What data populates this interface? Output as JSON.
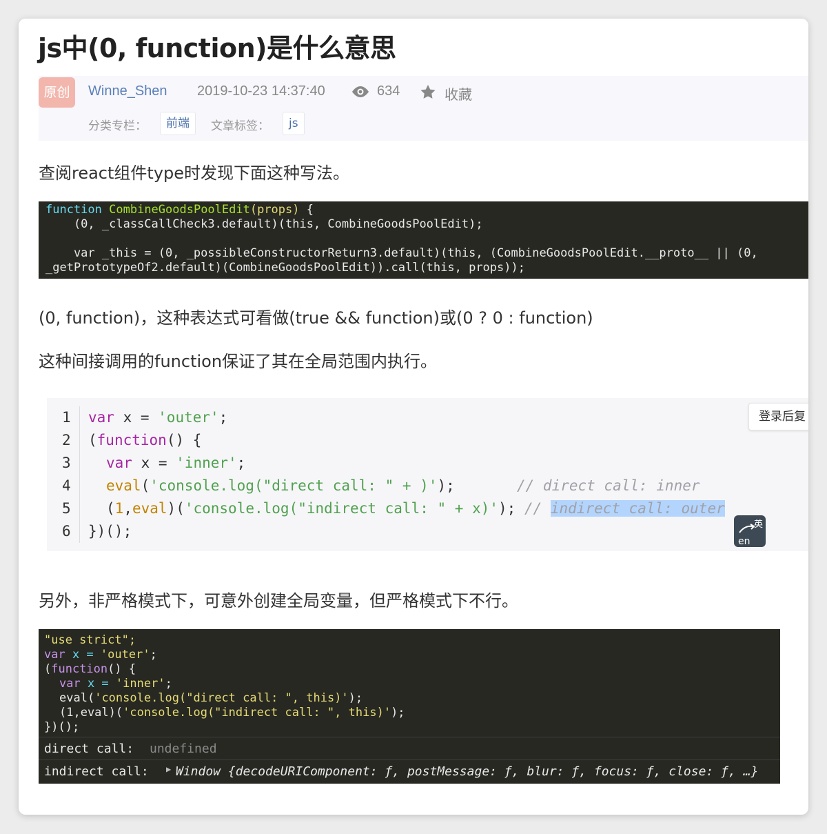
{
  "article": {
    "title": "js中(0, function)是什么意思",
    "badge": "原创",
    "author": "Winne_Shen",
    "date": "2019-10-23 14:37:40",
    "views": "634",
    "favorite": "收藏",
    "category_label": "分类专栏：",
    "category": "前端",
    "tags_label": "文章标签：",
    "tag": "js"
  },
  "paragraphs": {
    "p1": "查阅react组件type时发现下面这种写法。",
    "p2": "(0, function)，这种表达式可看做(true && function)或(0 ? 0 : function)",
    "p3": "这种间接调用的function保证了其在全局范围内执行。",
    "p4": "另外，非严格模式下，可意外创建全局变量，但严格模式下不行。"
  },
  "code1": {
    "l1_kw": "function",
    "l1_fn": "CombineGoodsPoolEdit",
    "l1_args": "(props)",
    "l1_brace": " {",
    "l2": "    (0, _classCallCheck3.default)(this, CombineGoodsPoolEdit);",
    "l3": "",
    "l4": "    var _this = (0, _possibleConstructorReturn3.default)(this, (CombineGoodsPoolEdit.__proto__ || (0,",
    "l5": "_getPrototypeOf2.default)(CombineGoodsPoolEdit)).call(this, props));"
  },
  "code2": {
    "line_numbers": [
      "1",
      "2",
      "3",
      "4",
      "5",
      "6"
    ],
    "lines": {
      "l1_kw": "var",
      "l1_rest": " x = ",
      "l1_str": "'outer'",
      "l1_end": ";",
      "l2_open": "(",
      "l2_kw": "function",
      "l2_rest": "() {",
      "l3_kw": "var",
      "l3_rest": " x = ",
      "l3_str": "'inner'",
      "l3_end": ";",
      "l4_fn": "eval",
      "l4_open": "(",
      "l4_str": "'console.log(\"direct call: \" + )'",
      "l4_end": ");",
      "l4_cm": "// direct call: inner",
      "l5_open": "(",
      "l5_num": "1",
      "l5_comma": ",",
      "l5_fn": "eval",
      "l5_mid": ")(",
      "l5_str": "'console.log(\"indirect call: \" + x)'",
      "l5_end": "); ",
      "l5_cm": "// ",
      "l5_sel": "indirect call: outer",
      "l6": "})();"
    },
    "login_button": "登录后复"
  },
  "code3": {
    "l1": "\"use strict\";",
    "l2_kw": "var",
    "l2_rest": " x = ",
    "l2_str": "'outer'",
    "l2_end": ";",
    "l3_open": "(",
    "l3_kw": "function",
    "l3_rest": "() {",
    "l4_kw": "var",
    "l4_rest": " x = ",
    "l4_str": "'inner'",
    "l4_end": ";",
    "l5_fn": "eval",
    "l5_open": "(",
    "l5_str": "'console.log(\"direct call: \", this)'",
    "l5_end": ");",
    "l6_open": "(1,eval)(",
    "l6_str": "'console.log(\"indirect call: \", this)'",
    "l6_end": ");",
    "l7": "})();",
    "out1_label": "direct call:",
    "out1_value": "undefined",
    "out2_label": "indirect call:",
    "out2_arrow": "▶",
    "out2_value": "Window {decodeURIComponent: ƒ, postMessage: ƒ, blur: ƒ, focus: ƒ, close: ƒ, …}"
  },
  "ime": {
    "top": "英",
    "bottom": "en"
  }
}
